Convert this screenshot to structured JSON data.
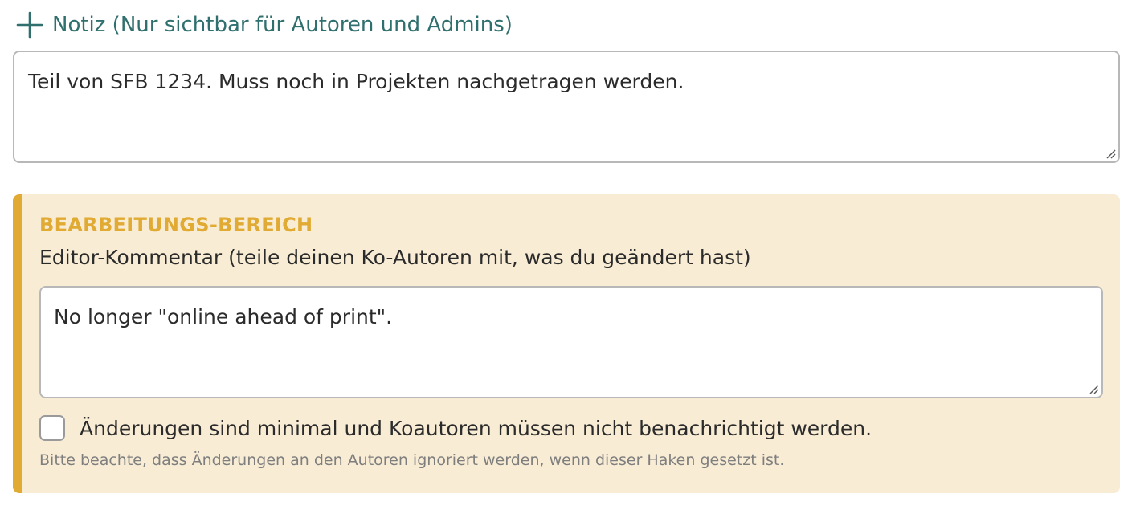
{
  "note_toggle": {
    "label": "Notiz (Nur sichtbar für Autoren und Admins)",
    "icon": "plus-icon",
    "color": "#2f6f6e"
  },
  "note_field": {
    "value": "Teil von SFB 1234. Muss noch in Projekten nachgetragen werden."
  },
  "edit_area": {
    "title": "BEARBEITUNGS-BEREICH",
    "comment_label": "Editor-Kommentar (teile deinen Ko-Autoren mit, was du geändert hast)",
    "comment_value": "No longer \"online ahead of print\".",
    "minor_change": {
      "label": "Änderungen sind minimal und Koautoren müssen nicht benachrichtigt werden.",
      "checked": false
    },
    "hint": "Bitte beachte, dass Änderungen an den Autoren ignoriert werden, wenn dieser Haken gesetzt ist.",
    "accent_color": "#e0aa33",
    "background_color": "#f8ecd5"
  }
}
